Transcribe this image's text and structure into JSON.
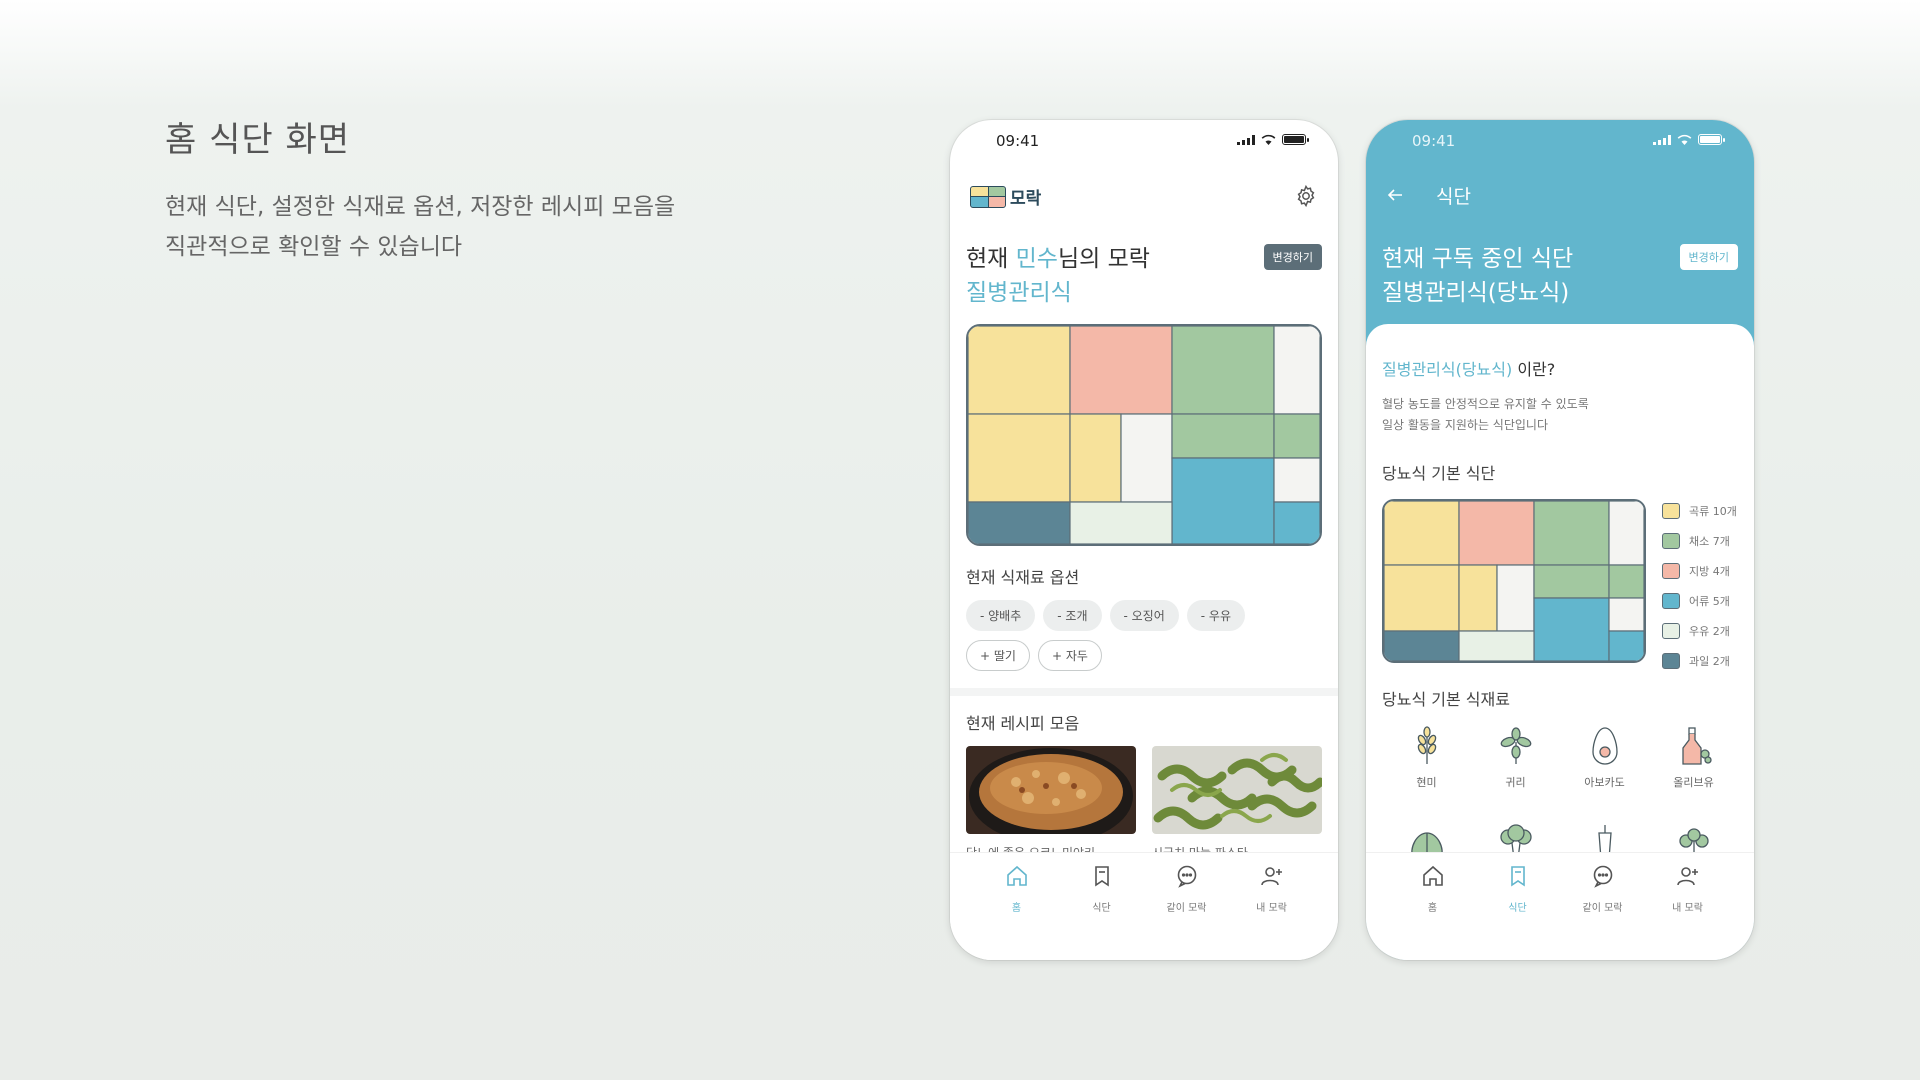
{
  "intro": {
    "title": "홈 식단 화면",
    "desc_line1": "현재 식단, 설정한 식재료 옵션, 저장한 레시피 모음을",
    "desc_line2": "직관적으로 확인할 수 있습니다"
  },
  "colors": {
    "accent": "#62b6cd",
    "grain": "#f7e29b",
    "vegetable": "#a2c8a0",
    "fat": "#f4b8a8",
    "fish": "#62b6cd",
    "milk": "#e8f1e6",
    "fruit": "#5c8595",
    "border": "#5c6e78"
  },
  "phone1": {
    "time": "09:41",
    "logo_text": "모락",
    "title_prefix": "현재 ",
    "title_name": "민수",
    "title_suffix": "님의 모락",
    "diet_name": "질병관리식",
    "change_button": "변경하기",
    "options_title": "현재 식재료 옵션",
    "options": [
      "- 양배추",
      "- 조개",
      "- 오징어",
      "- 우유"
    ],
    "options_added": [
      "+ 딸기",
      "+ 자두"
    ],
    "recipes_title": "현재 레시피 모음",
    "recipes": [
      {
        "caption": "당뇨에 좋은 오코노미야키"
      },
      {
        "caption": "시금치 마늘 파스타"
      }
    ],
    "tabs": [
      "홈",
      "식단",
      "같이 모락",
      "내 모락"
    ],
    "active_tab": "홈"
  },
  "phone2": {
    "time": "09:41",
    "header": "식단",
    "title_line1": "현재 구독 중인 식단",
    "title_line2": "질병관리식(당뇨식)",
    "change_button": "변경하기",
    "question_accent": "질병관리식(당뇨식)",
    "question_suffix": " 이란?",
    "desc_line1": "혈당 농도를 안정적으로 유지할 수 있도록",
    "desc_line2": "일상 활동을 지원하는 식단입니다",
    "base_diet_title": "당뇨식 기본 식단",
    "legend": [
      {
        "label": "곡류 10개",
        "color": "#f7e29b"
      },
      {
        "label": "채소 7개",
        "color": "#a2c8a0"
      },
      {
        "label": "지방 4개",
        "color": "#f4b8a8"
      },
      {
        "label": "어류 5개",
        "color": "#62b6cd"
      },
      {
        "label": "우유 2개",
        "color": "#e8f1e6"
      },
      {
        "label": "과일 2개",
        "color": "#5c8595"
      }
    ],
    "ingredients_title": "당뇨식 기본 식재료",
    "ingredients": [
      {
        "label": "현미",
        "icon": "rice-icon"
      },
      {
        "label": "귀리",
        "icon": "oat-icon"
      },
      {
        "label": "아보카도",
        "icon": "avocado-icon"
      },
      {
        "label": "올리브유",
        "icon": "olive-oil-icon"
      }
    ],
    "tabs": [
      "홈",
      "식단",
      "같이 모락",
      "내 모락"
    ],
    "active_tab": "식단"
  }
}
